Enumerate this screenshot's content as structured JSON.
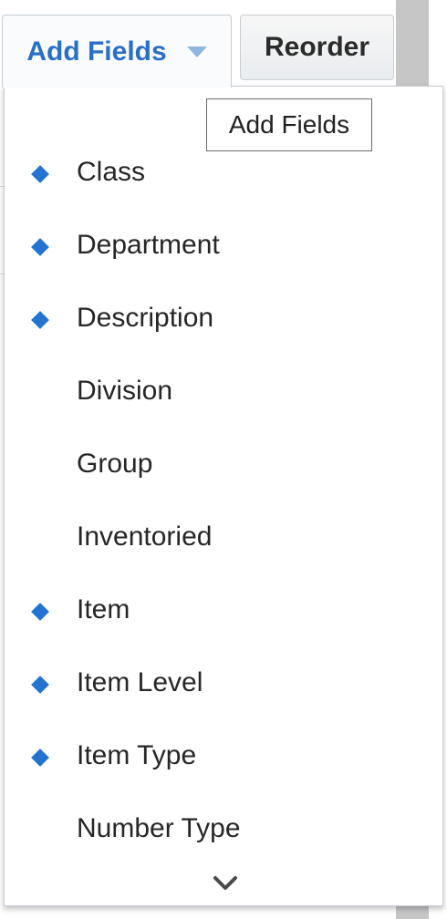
{
  "toolbar": {
    "add_fields_label": "Add Fields",
    "reorder_label": "Reorder"
  },
  "tooltip": {
    "text": "Add Fields"
  },
  "menu": {
    "items": [
      {
        "label": "Class",
        "selected": true
      },
      {
        "label": "Department",
        "selected": true
      },
      {
        "label": "Description",
        "selected": true
      },
      {
        "label": "Division",
        "selected": false
      },
      {
        "label": "Group",
        "selected": false
      },
      {
        "label": "Inventoried",
        "selected": false
      },
      {
        "label": "Item",
        "selected": true
      },
      {
        "label": "Item Level",
        "selected": true
      },
      {
        "label": "Item Type",
        "selected": true
      },
      {
        "label": "Number Type",
        "selected": false
      }
    ],
    "scroll_icon": "chevron-down-icon"
  },
  "colors": {
    "accent": "#2a6fc7",
    "marker": "#2473d0",
    "edge_strip": "#c6c6c6"
  }
}
